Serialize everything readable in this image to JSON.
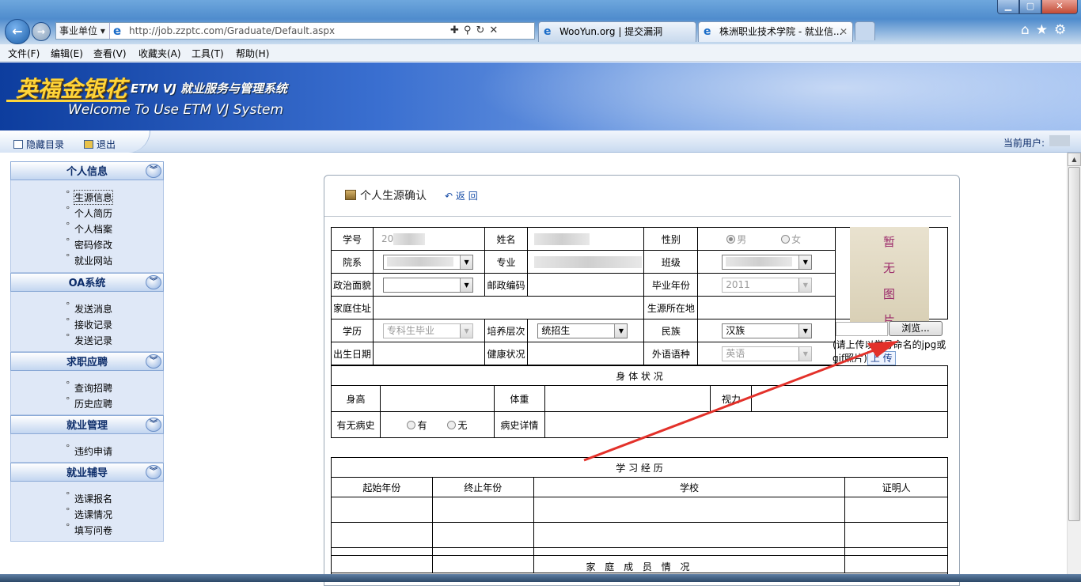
{
  "browser": {
    "zone": "事业单位",
    "url": "http://job.zzptc.com/Graduate/Default.aspx",
    "tabs": [
      {
        "label": "WooYun.org | 提交漏洞"
      },
      {
        "label": "株洲职业技术学院 - 就业信..."
      }
    ],
    "menu": [
      "文件(F)",
      "编辑(E)",
      "查看(V)",
      "收藏夹(A)",
      "工具(T)",
      "帮助(H)"
    ]
  },
  "banner": {
    "logo": "英福金银花",
    "title": "ETM VJ 就业服务与管理系统",
    "welcome": "Welcome To Use ETM  VJ  System"
  },
  "toolbar": {
    "hide_menu": "隐藏目录",
    "logout": "退出",
    "current_user_label": "当前用户:"
  },
  "nav": [
    {
      "title": "个人信息",
      "items": [
        "生源信息",
        "个人简历",
        "个人档案",
        "密码修改",
        "就业网站"
      ]
    },
    {
      "title": "OA系统",
      "items": [
        "发送消息",
        "接收记录",
        "发送记录"
      ]
    },
    {
      "title": "求职应聘",
      "items": [
        "查询招聘",
        "历史应聘"
      ]
    },
    {
      "title": "就业管理",
      "items": [
        "违约申请"
      ]
    },
    {
      "title": "就业辅导",
      "items": [
        "选课报名",
        "选课情况",
        "填写问卷"
      ]
    }
  ],
  "panel": {
    "title": "个人生源确认",
    "back": "返 回"
  },
  "form": {
    "student_no_label": "学号",
    "student_no_value": "20",
    "name_label": "姓名",
    "gender_label": "性别",
    "gender_male": "男",
    "gender_female": "女",
    "dept_label": "院系",
    "major_label": "专业",
    "class_label": "班级",
    "politics_label": "政治面貌",
    "postcode_label": "邮政编码",
    "grad_year_label": "毕业年份",
    "grad_year_value": "2011",
    "address_label": "家庭住址",
    "origin_label": "生源所在地",
    "edu_label": "学历",
    "edu_value": "专科生毕业",
    "training_label": "培养层次",
    "training_value": "统招生",
    "ethnic_label": "民族",
    "ethnic_value": "汉族",
    "birth_label": "出生日期",
    "health_label": "健康状况",
    "lang_label": "外语语种",
    "lang_value": "英语",
    "photo_placeholder": "暂无图片",
    "browse": "浏览...",
    "upload_hint": "(请上传以学号命名的jpg或gif照片)",
    "upload": "上 传"
  },
  "body_section": {
    "title": "身 体 状 况",
    "height": "身高",
    "weight": "体重",
    "vision": "视力",
    "history": "有无病史",
    "yes": "有",
    "no": "无",
    "history_detail": "病史详情"
  },
  "study_section": {
    "title": "学 习 经 历",
    "columns": [
      "起始年份",
      "终止年份",
      "学校",
      "证明人"
    ]
  },
  "family_section": {
    "title": "家 庭 成 员 情 况"
  },
  "colors": {
    "banner_dark": "#0d3d9e",
    "logo_gold": "#ffd53a",
    "nav_bg": "#dfe8f7",
    "arrow_red": "#e3312a"
  }
}
